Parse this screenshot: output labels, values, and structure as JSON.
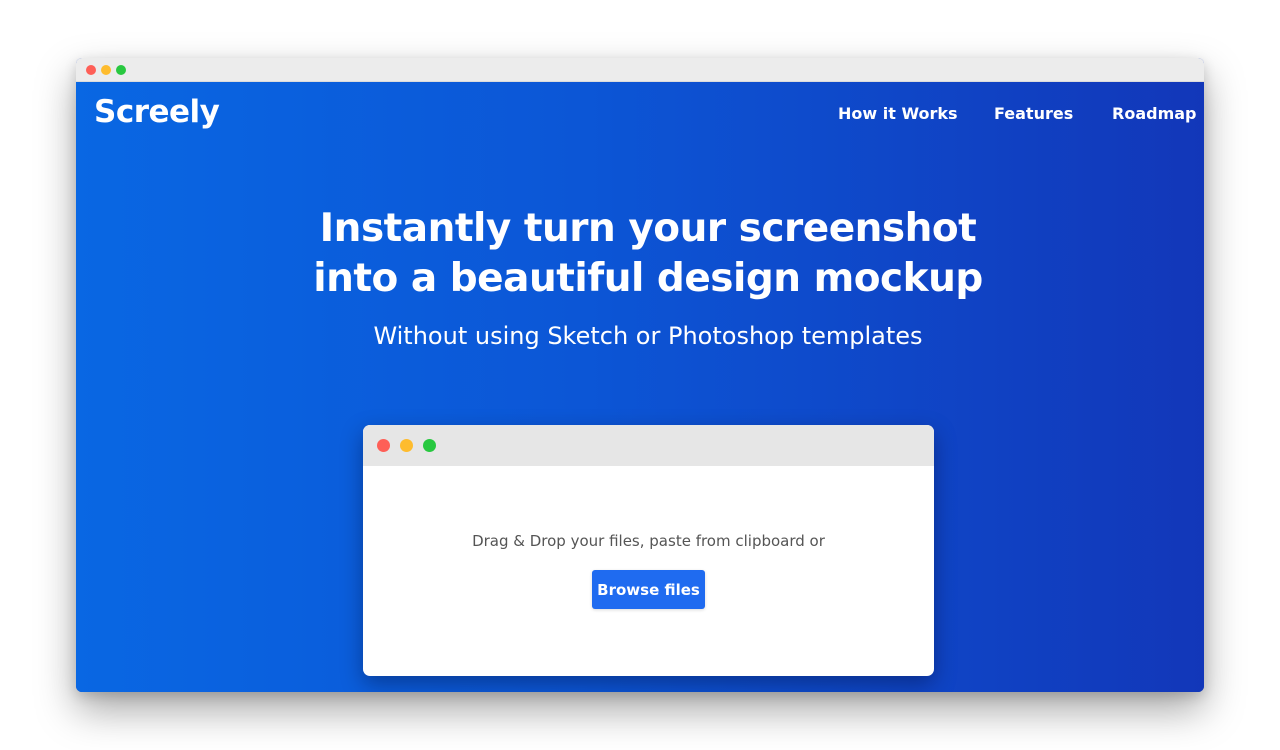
{
  "outer_window": {
    "controls": [
      {
        "name": "close",
        "color": "#fe5f57"
      },
      {
        "name": "minimize",
        "color": "#febc2e"
      },
      {
        "name": "maximize",
        "color": "#28c840"
      }
    ]
  },
  "header": {
    "logo": "Screely",
    "nav": [
      "How it Works",
      "Features",
      "Roadmap"
    ]
  },
  "hero": {
    "headline_line1": "Instantly turn your screenshot",
    "headline_line2": "into a beautiful design mockup",
    "subheadline": "Without using Sketch or Photoshop templates",
    "gradient": [
      "#0967e3",
      "#1237b9"
    ]
  },
  "upload": {
    "controls": [
      {
        "name": "close",
        "color": "#fe5f57"
      },
      {
        "name": "minimize",
        "color": "#febc2e"
      },
      {
        "name": "maximize",
        "color": "#28c840"
      }
    ],
    "instruction": "Drag & Drop your files, paste from clipboard or",
    "browse_label": "Browse files",
    "button_color": "#1f6bf0"
  }
}
